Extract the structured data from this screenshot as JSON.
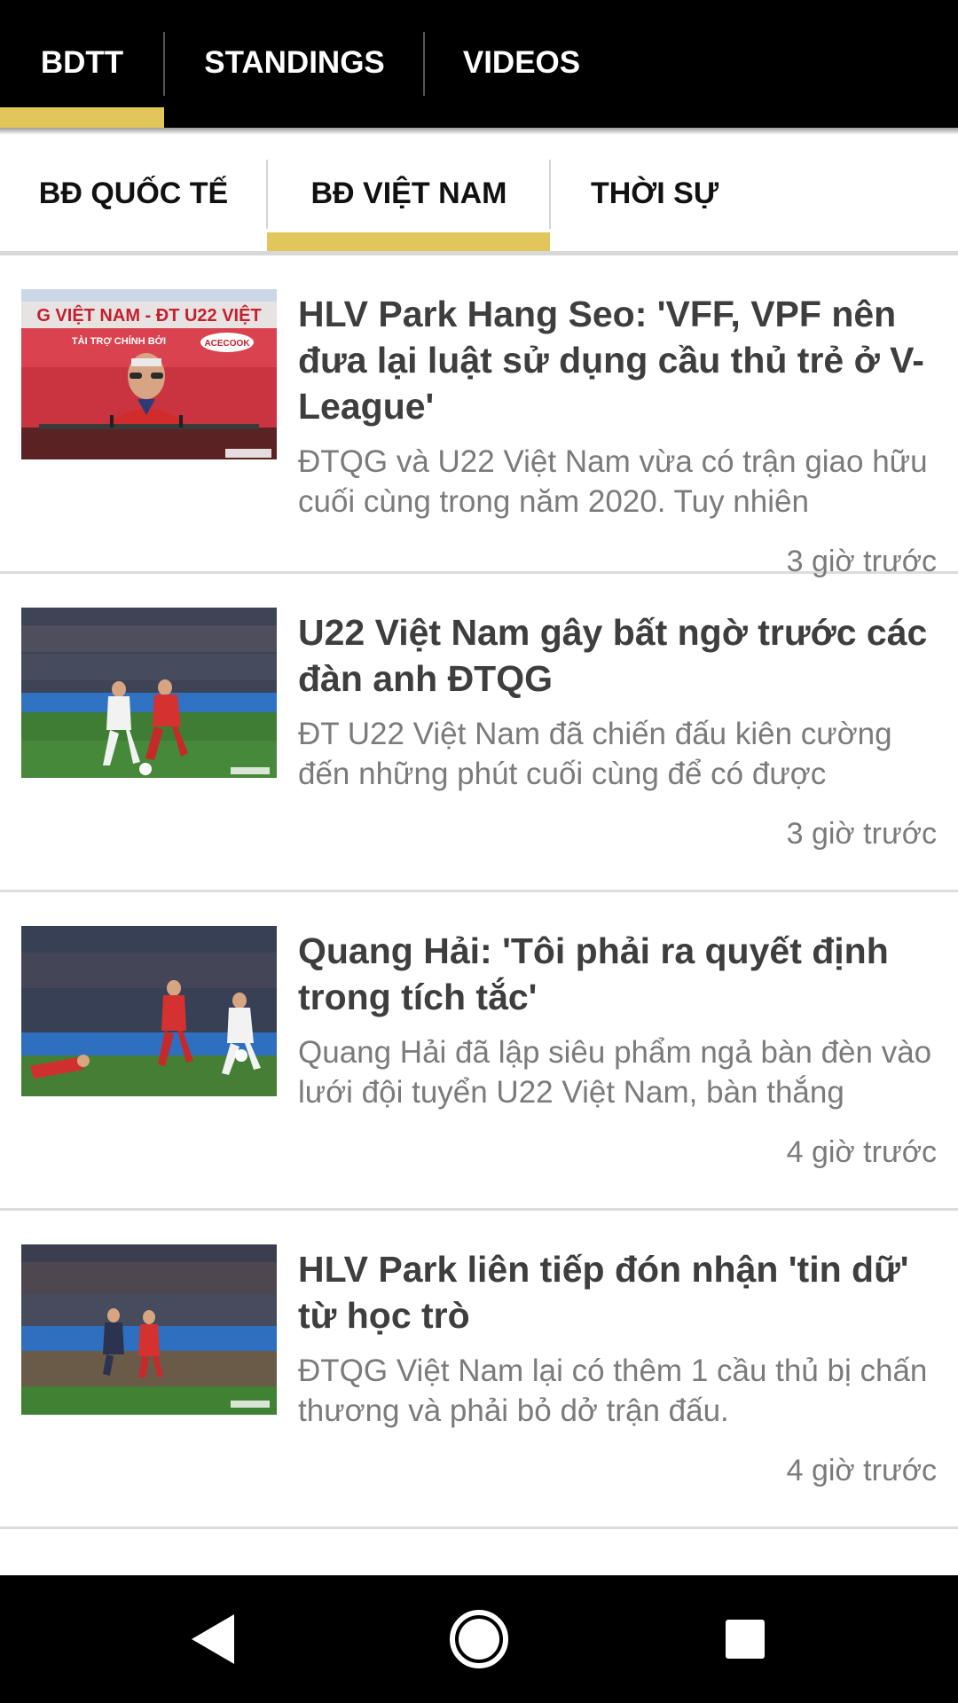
{
  "top_tabs": {
    "items": [
      {
        "label": "BDTT",
        "active": true
      },
      {
        "label": "STANDINGS",
        "active": false
      },
      {
        "label": "VIDEOS",
        "active": false
      }
    ]
  },
  "sub_tabs": {
    "items": [
      {
        "label": "BĐ QUỐC TẾ",
        "active": false
      },
      {
        "label": "BĐ VIỆT NAM",
        "active": true
      },
      {
        "label": "THỜI SỰ",
        "active": false
      }
    ]
  },
  "news": [
    {
      "title": "HLV Park Hang Seo: 'VFF, VPF nên đưa lại luật sử dụng cầu thủ trẻ ở V-League'",
      "summary": "ĐTQG và U22 Việt Nam vừa có trận giao hữu cuối cùng trong năm 2020. Tuy nhiên",
      "time": "3 giờ trước",
      "thumb_banner": "G VIỆT NAM - ĐT U22 VIỆT",
      "thumb_sponsor": "TÀI TRỢ CHÍNH BỞI",
      "thumb_brand": "ACECOOK"
    },
    {
      "title": "U22 Việt Nam gây bất ngờ trước các đàn anh ĐTQG",
      "summary": "ĐT U22 Việt Nam đã chiến đấu kiên cường đến những phút cuối cùng để có được",
      "time": "3 giờ trước"
    },
    {
      "title": "Quang Hải: 'Tôi phải ra quyết định trong tích tắc'",
      "summary": "Quang Hải đã lập siêu phẩm ngả bàn đèn vào lưới đội tuyển U22 Việt Nam, bàn thắng",
      "time": "4 giờ trước"
    },
    {
      "title": "HLV Park liên tiếp đón nhận 'tin dữ' từ học trò",
      "summary": "ĐTQG Việt Nam lại có thêm 1 cầu thủ bị chấn thương và phải bỏ dở trận đấu.",
      "time": "4 giờ trước"
    }
  ],
  "nav": {
    "back_icon": "back-triangle-icon",
    "home_icon": "home-circle-icon",
    "recents_icon": "recents-square-icon"
  },
  "colors": {
    "accent": "#E2C65A",
    "top_bar": "#000000",
    "title_text": "#3E3E3E",
    "meta_text": "#7B7B7B"
  }
}
